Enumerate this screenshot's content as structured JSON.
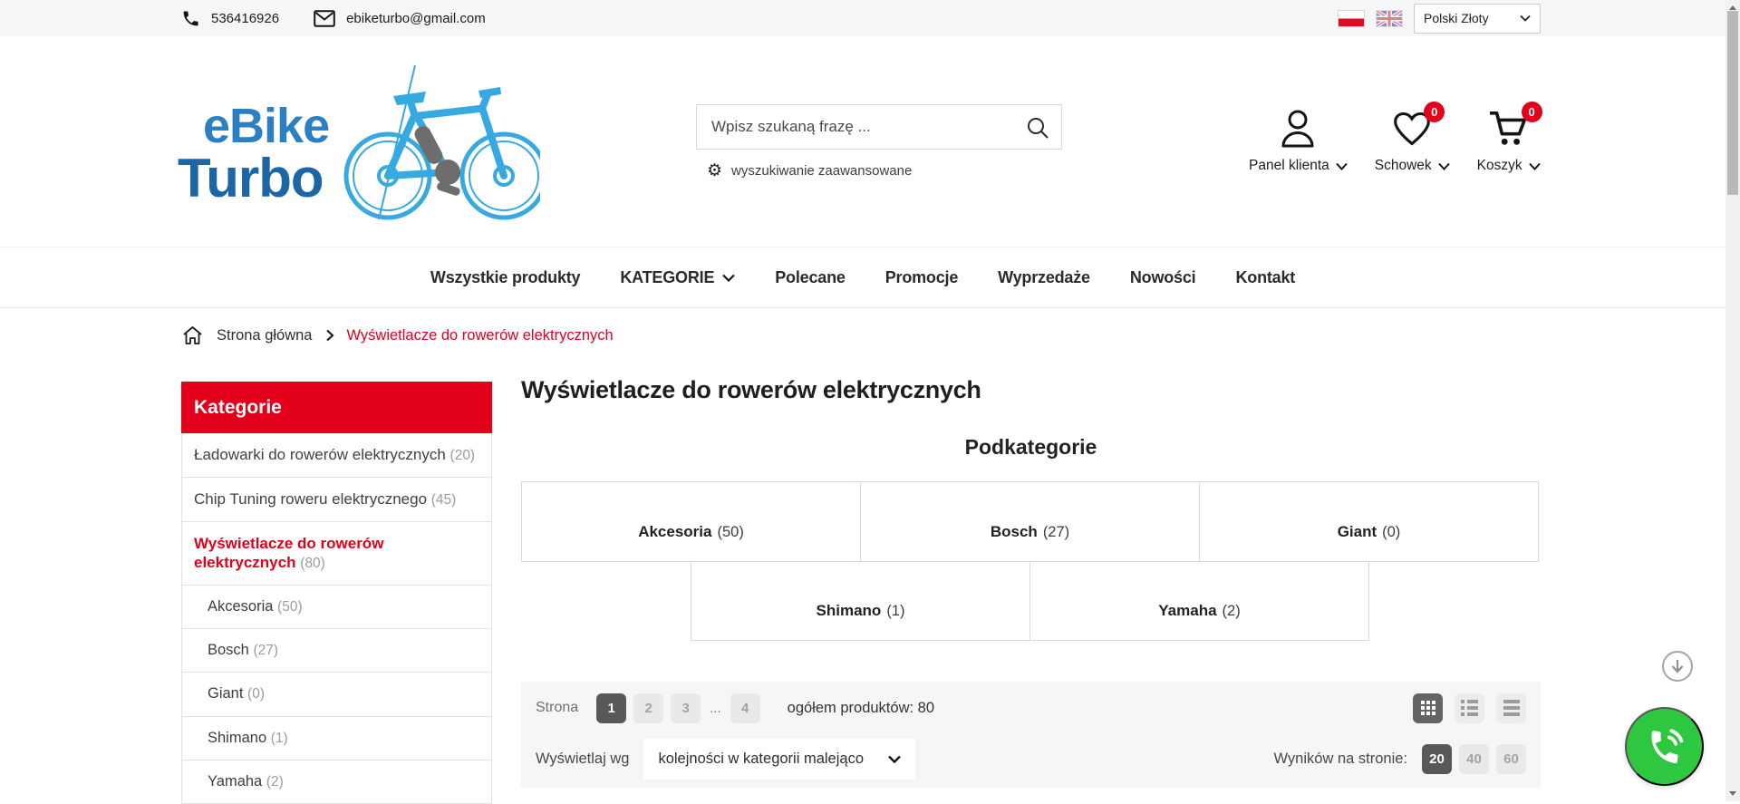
{
  "topbar": {
    "phone": "536416926",
    "email": "ebiketurbo@gmail.com",
    "currency": "Polski Złoty"
  },
  "header": {
    "logo_line1": "eBike",
    "logo_line2": "Turbo",
    "search_placeholder": "Wpisz szukaną frazę ...",
    "advanced_search": "wyszukiwanie zaawansowane",
    "account_label": "Panel klienta",
    "wishlist_label": "Schowek",
    "wishlist_count": "0",
    "cart_label": "Koszyk",
    "cart_count": "0"
  },
  "nav": {
    "items": [
      {
        "label": "Wszystkie produkty"
      },
      {
        "label": "KATEGORIE"
      },
      {
        "label": "Polecane"
      },
      {
        "label": "Promocje"
      },
      {
        "label": "Wyprzedaże"
      },
      {
        "label": "Nowości"
      },
      {
        "label": "Kontakt"
      }
    ]
  },
  "breadcrumb": {
    "home": "Strona główna",
    "current": "Wyświetlacze do rowerów elektrycznych"
  },
  "sidebar": {
    "title": "Kategorie",
    "items": [
      {
        "label": "Ładowarki do rowerów elektrycznych",
        "count": "(20)"
      },
      {
        "label": "Chip Tuning roweru elektrycznego",
        "count": "(45)"
      },
      {
        "label": "Wyświetlacze do rowerów elektrycznych",
        "count": "(80)"
      },
      {
        "label": "Akcesoria",
        "count": "(50)"
      },
      {
        "label": "Bosch",
        "count": "(27)"
      },
      {
        "label": "Giant",
        "count": "(0)"
      },
      {
        "label": "Shimano",
        "count": "(1)"
      },
      {
        "label": "Yamaha",
        "count": "(2)"
      }
    ]
  },
  "main": {
    "title": "Wyświetlacze do rowerów elektrycznych",
    "subcategories_title": "Podkategorie",
    "subcategories": [
      {
        "name": "Akcesoria",
        "count": "(50)"
      },
      {
        "name": "Bosch",
        "count": "(27)"
      },
      {
        "name": "Giant",
        "count": "(0)"
      },
      {
        "name": "Shimano",
        "count": "(1)"
      },
      {
        "name": "Yamaha",
        "count": "(2)"
      }
    ],
    "pagination": {
      "label": "Strona",
      "pages": [
        "1",
        "2",
        "3",
        "4"
      ],
      "ellipsis": "...",
      "total": "ogółem produktów: 80"
    },
    "sort": {
      "label": "Wyświetlaj wg",
      "value": "kolejności w kategorii malejąco"
    },
    "per_page": {
      "label": "Wyników na stronie:",
      "options": [
        "20",
        "40",
        "60"
      ]
    }
  },
  "colors": {
    "accent_red": "#e2001a",
    "logo_blue": "#2c7fc0",
    "phone_green": "#2ec840"
  }
}
